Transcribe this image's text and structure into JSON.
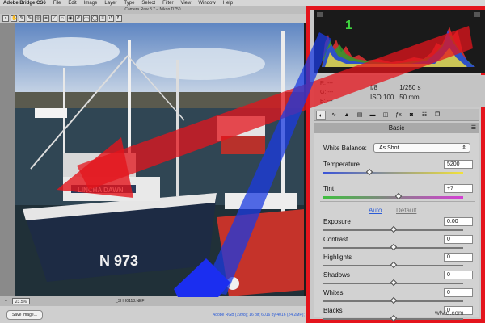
{
  "menubar": {
    "items": [
      "Adobe Bridge CS6",
      "File",
      "Edit",
      "Image",
      "Layer",
      "Type",
      "Select",
      "Filter",
      "View",
      "Window",
      "Help"
    ]
  },
  "window": {
    "title": "Camera Raw 8.7  –  Nikon D750"
  },
  "statusbar": {
    "zoom": "23.5%",
    "filename": "_SHH0118.NEF",
    "save_button": "Save Image...",
    "workflow_link": "Adobe RGB (1998); 16 bit; 6016 by 4016 (24.2MP); 300 ppi"
  },
  "histogram": {
    "badge": "1"
  },
  "info": {
    "r_label": "R:",
    "r_value": "---",
    "g_label": "G:",
    "g_value": "---",
    "b_label": "B:",
    "b_value": "---",
    "aperture": "f/8",
    "shutter": "1/250 s",
    "iso": "ISO 100",
    "focal": "50 mm"
  },
  "panel": {
    "title": "Basic",
    "white_balance_label": "White Balance:",
    "white_balance_value": "As Shot",
    "auto_label": "Auto",
    "default_label": "Default",
    "sliders": [
      {
        "label": "Temperature",
        "value": "5200",
        "level": 0.33
      },
      {
        "label": "Tint",
        "value": "+7",
        "level": 0.54
      },
      {
        "label": "Exposure",
        "value": "0.00",
        "level": 0.5
      },
      {
        "label": "Contrast",
        "value": "0",
        "level": 0.5
      },
      {
        "label": "Highlights",
        "value": "0",
        "level": 0.5
      },
      {
        "label": "Shadows",
        "value": "0",
        "level": 0.5
      },
      {
        "label": "Whites",
        "value": "0",
        "level": 0.5
      },
      {
        "label": "Blacks",
        "value": "0",
        "level": 0.5
      }
    ]
  },
  "watermark": "wtvid.com",
  "colors": {
    "highlight_border": "#e4141c",
    "link": "#2a5bd7"
  }
}
